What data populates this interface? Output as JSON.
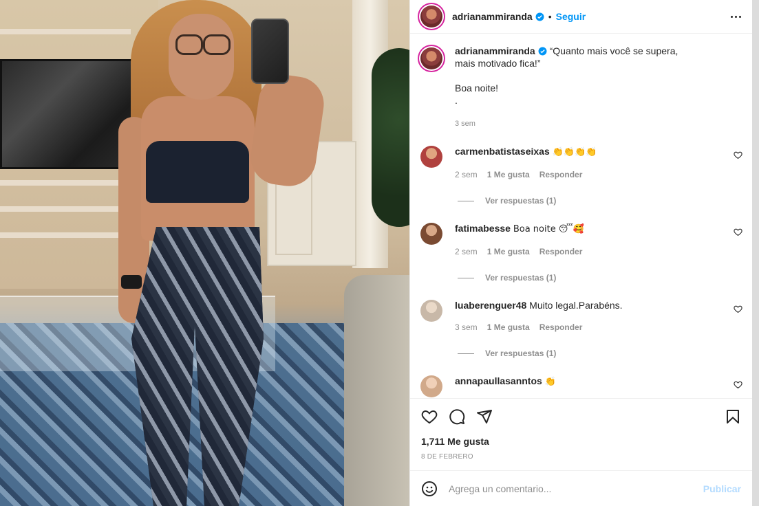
{
  "header": {
    "username": "adrianammiranda",
    "separator": "•",
    "follow_label": "Seguir"
  },
  "caption": {
    "username": "adrianammiranda",
    "line1": "“Quanto mais você se supera,",
    "line2": "mais motivado fica!”",
    "line3": "Boa noite!",
    "line4": ".",
    "time": "3 sem"
  },
  "comments": [
    {
      "username": "carmenbatistaseixas",
      "text": "👏👏👏👏",
      "time": "2 sem",
      "likes": "1 Me gusta",
      "reply": "Responder",
      "replies": "Ver respuestas (1)",
      "avatar_color": "#b0413e"
    },
    {
      "username": "fatimabesse",
      "text": "Boa noite 😴🥰",
      "time": "2 sem",
      "likes": "1 Me gusta",
      "reply": "Responder",
      "replies": "Ver respuestas (1)",
      "avatar_color": "#7a4a32"
    },
    {
      "username": "luaberenguer48",
      "text": "Muito legal.Parabéns.",
      "time": "3 sem",
      "likes": "1 Me gusta",
      "reply": "Responder",
      "replies": "Ver respuestas (1)",
      "avatar_color": "#c8b8a8"
    },
    {
      "username": "annapaullasanntos",
      "text": "👏",
      "avatar_color": "#d1a98a"
    }
  ],
  "footer": {
    "likes": "1,711 Me gusta",
    "date": "8 DE FEBRERO",
    "comment_placeholder": "Agrega un comentario...",
    "publish_label": "Publicar"
  },
  "icons": [
    "verified-icon",
    "more-options-icon",
    "heart-icon",
    "comment-icon",
    "share-icon",
    "bookmark-icon",
    "emoji-icon"
  ],
  "colors": {
    "accent": "#0095f6",
    "publish_disabled": "#b3dbff",
    "muted": "#8e8e8e"
  }
}
